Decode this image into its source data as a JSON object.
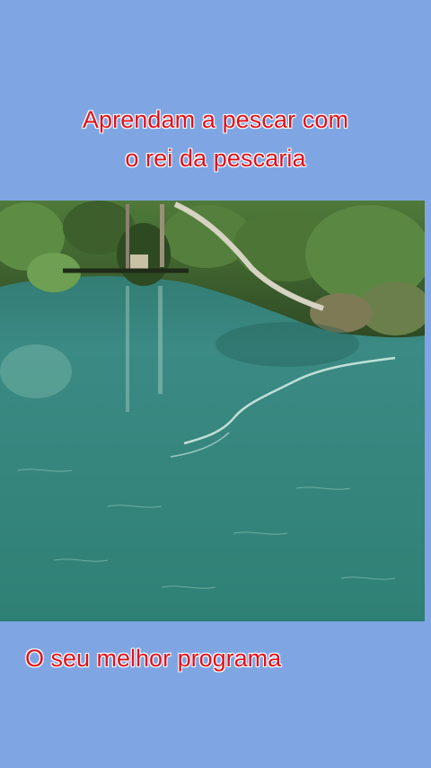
{
  "post": {
    "headline_line1": "Aprendam a pescar com",
    "headline_line2": "o rei da pescaria",
    "footer_caption": "O seu melhor programa"
  },
  "colors": {
    "background": "#7fa6e3",
    "caption_text": "#e0101a",
    "caption_outline": "#ffffff",
    "water": "#2f7d78",
    "foliage": "#3f6a2e"
  }
}
